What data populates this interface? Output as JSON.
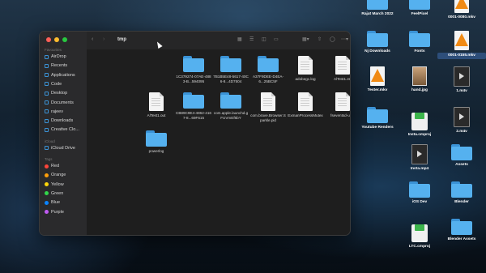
{
  "window": {
    "title": "tmp",
    "traffic": {
      "close": "#ff5f57",
      "minimize": "#febc2e",
      "zoom": "#28c840"
    }
  },
  "sidebar": {
    "favourites_header": "Favourites",
    "favourites": [
      {
        "label": "AirDrop",
        "icon": "airdrop-icon"
      },
      {
        "label": "Recents",
        "icon": "clock-icon"
      },
      {
        "label": "Applications",
        "icon": "applications-icon"
      },
      {
        "label": "Code",
        "icon": "folder-icon"
      },
      {
        "label": "Desktop",
        "icon": "desktop-icon"
      },
      {
        "label": "Documents",
        "icon": "document-icon"
      },
      {
        "label": "rajeev",
        "icon": "home-icon"
      },
      {
        "label": "Downloads",
        "icon": "download-icon"
      },
      {
        "label": "Creative Clo...",
        "icon": "cloud-icon"
      }
    ],
    "icloud_header": "iCloud",
    "icloud": [
      {
        "label": "iCloud Drive",
        "icon": "icloud-icon"
      }
    ],
    "tags_header": "Tags",
    "tags": [
      {
        "label": "Red",
        "color": "#ff453a"
      },
      {
        "label": "Orange",
        "color": "#ff9f0a"
      },
      {
        "label": "Yellow",
        "color": "#ffd60a"
      },
      {
        "label": "Green",
        "color": "#32d74b"
      },
      {
        "label": "Blue",
        "color": "#0a84ff"
      },
      {
        "label": "Purple",
        "color": "#bf5af2"
      }
    ]
  },
  "files": [
    {
      "name": "1C379274-07AE-4883-B...594095",
      "kind": "folder"
    },
    {
      "name": "7B1B5E48-5617-40C6-8...4D7504",
      "kind": "folder"
    },
    {
      "name": "A37F9DEE-D4EA-6...25BC5F",
      "kind": "folder"
    },
    {
      "name": "adobegc.log",
      "kind": "doc"
    },
    {
      "name": "AlTest1.err",
      "kind": "doc"
    },
    {
      "name": "AlTest1.out",
      "kind": "doc"
    },
    {
      "name": "CB89C9E4-4862-4167-8...69F615",
      "kind": "folder"
    },
    {
      "name": "com.apple.launchd.gFUVmEf6bY",
      "kind": "folder"
    },
    {
      "name": "com.brave.Browser.Sparkle.pid",
      "kind": "doc"
    },
    {
      "name": "ExmanProcessMutex",
      "kind": "doc"
    },
    {
      "name": "fseventsd-uuid",
      "kind": "doc"
    },
    {
      "name": "powerlog",
      "kind": "folder"
    }
  ],
  "desktop": [
    {
      "name": "Rajat March 2022",
      "kind": "folder"
    },
    {
      "name": "FeelPixel",
      "kind": "folder"
    },
    {
      "name": "0001-0080.mkv",
      "kind": "vlc"
    },
    {
      "name": "Nj Downloads",
      "kind": "folder"
    },
    {
      "name": "Fonts",
      "kind": "folder"
    },
    {
      "name": "0001-0155.mkv",
      "kind": "vlc",
      "selected": true
    },
    {
      "name": "Tester.mkv",
      "kind": "vlc"
    },
    {
      "name": "hand.jpg",
      "kind": "image"
    },
    {
      "name": "1.m4v",
      "kind": "video"
    },
    {
      "name": "Youtube Renders",
      "kind": "folder"
    },
    {
      "name": "Insta.cmproj",
      "kind": "cmproj"
    },
    {
      "name": "2.m4v",
      "kind": "video"
    },
    {
      "name": "Insta.mp4",
      "kind": "video"
    },
    {
      "name": "Assets",
      "kind": "folder"
    },
    {
      "name": "iOS Dev",
      "kind": "folder"
    },
    {
      "name": "Blender",
      "kind": "folder"
    },
    {
      "name": "LTC.cmproj",
      "kind": "cmproj"
    },
    {
      "name": "Blender Assets",
      "kind": "folder"
    }
  ]
}
